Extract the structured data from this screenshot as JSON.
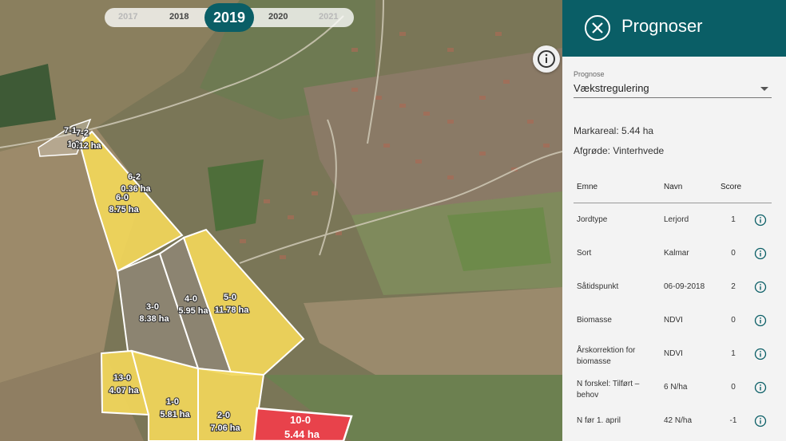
{
  "years": {
    "items": [
      "2017",
      "2018",
      "2020",
      "2021"
    ],
    "active": "2019"
  },
  "panel": {
    "title": "Prognoser",
    "select_label": "Prognose",
    "select_value": "Vækstregulering",
    "markareal": "Markareal: 5.44 ha",
    "afgrode": "Afgrøde: Vinterhvede"
  },
  "table": {
    "headers": [
      "Emne",
      "Navn",
      "Score"
    ],
    "rows": [
      {
        "emne": "Jordtype",
        "navn": "Lerjord",
        "score": "1"
      },
      {
        "emne": "Sort",
        "navn": "Kalmar",
        "score": "0"
      },
      {
        "emne": "Såtidspunkt",
        "navn": "06-09-2018",
        "score": "2"
      },
      {
        "emne": "Biomasse",
        "navn": "NDVI",
        "score": "0"
      },
      {
        "emne": "Årskorrektion for biomasse",
        "navn": "NDVI",
        "score": "1"
      },
      {
        "emne": "N forskel: Tilført – behov",
        "navn": "6 N/ha",
        "score": "0"
      },
      {
        "emne": "N før 1. april",
        "navn": "42 N/ha",
        "score": "-1"
      }
    ]
  },
  "fields": [
    {
      "id": "7-1",
      "area": "1.0"
    },
    {
      "id": "7-2",
      "area": "0.12 ha"
    },
    {
      "id": "6-2",
      "area": "0.36 ha"
    },
    {
      "id": "6-0",
      "area": "8.75 ha"
    },
    {
      "id": "3-0",
      "area": "8.38 ha"
    },
    {
      "id": "4-0",
      "area": "5.95 ha"
    },
    {
      "id": "5-0",
      "area": "11.78 ha"
    },
    {
      "id": "13-0",
      "area": "4.07 ha"
    },
    {
      "id": "1-0",
      "area": "5.81 ha"
    },
    {
      "id": "2-0",
      "area": "7.06 ha"
    },
    {
      "id": "10-0",
      "area": "5.44 ha"
    }
  ],
  "colors": {
    "accent": "#0a5e66",
    "field_yellow": "#f2d75a",
    "field_grey": "#8f8775",
    "field_selected": "#e8424b"
  },
  "icons": {
    "close": "close-circle-icon",
    "info": "info-icon",
    "caret": "chevron-down-icon"
  }
}
